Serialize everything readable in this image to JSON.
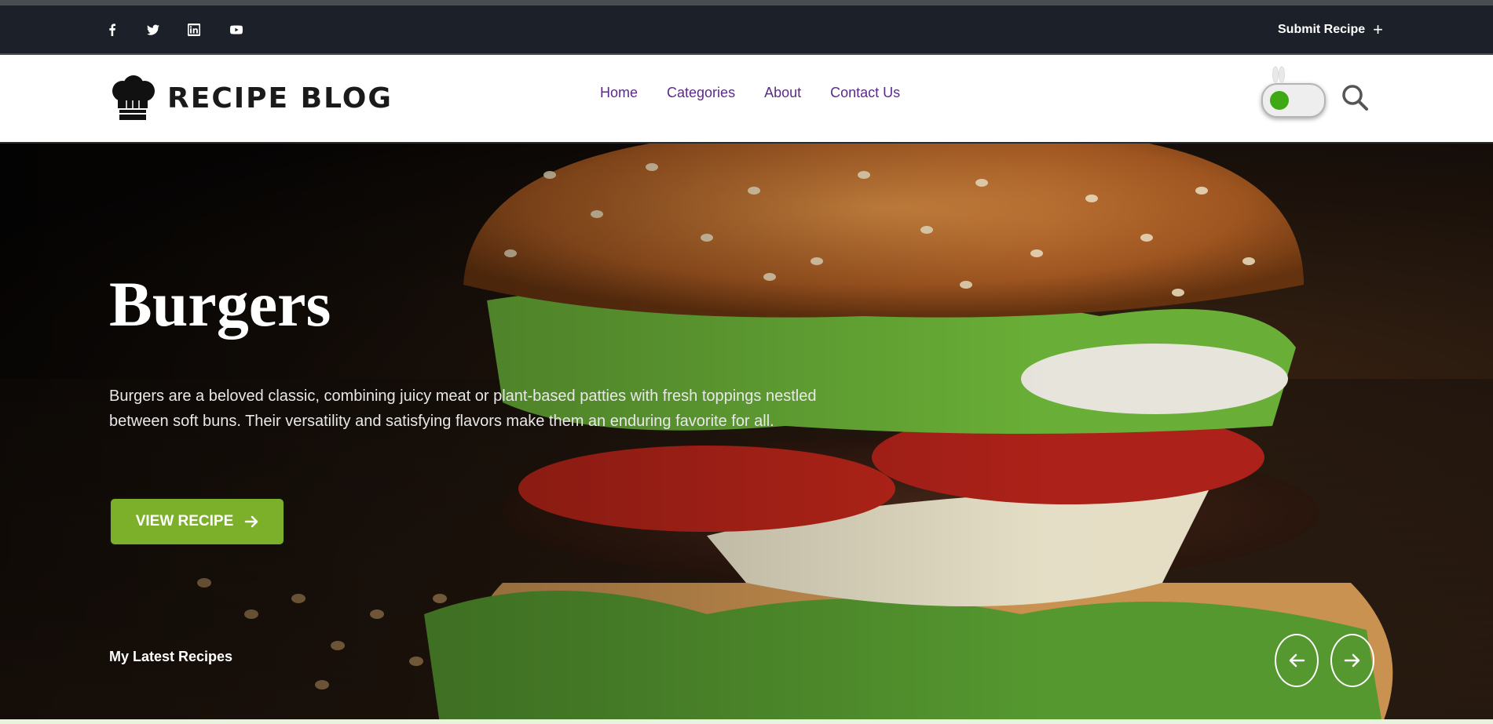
{
  "topbar": {
    "social_icons": [
      "facebook-icon",
      "twitter-icon",
      "linkedin-icon",
      "youtube-icon"
    ],
    "submit_label": "Submit Recipe",
    "submit_icon": "+"
  },
  "brand": {
    "name": "RECIPE BLOG",
    "logo_icon": "chef-hat-icon"
  },
  "nav": {
    "items": [
      "Home",
      "Categories",
      "About",
      "Contact Us"
    ]
  },
  "controls": {
    "theme_toggle_state": "on",
    "search_icon": "search-icon"
  },
  "hero": {
    "title": "Burgers",
    "description": "Burgers are a beloved classic, combining juicy meat or plant-based patties with fresh toppings nestled between soft buns. Their versatility and satisfying flavors make them an enduring favorite for all.",
    "button_label": "VIEW RECIPE",
    "button_icon": "arrow-right-icon",
    "latest_label": "My Latest Recipes",
    "prev_icon": "arrow-left-icon",
    "next_icon": "arrow-right-icon"
  },
  "colors": {
    "topbar_bg": "#1c2129",
    "nav_link": "#5b2a86",
    "accent_green": "#7cb02b",
    "toggle_knob": "#3ea815"
  }
}
